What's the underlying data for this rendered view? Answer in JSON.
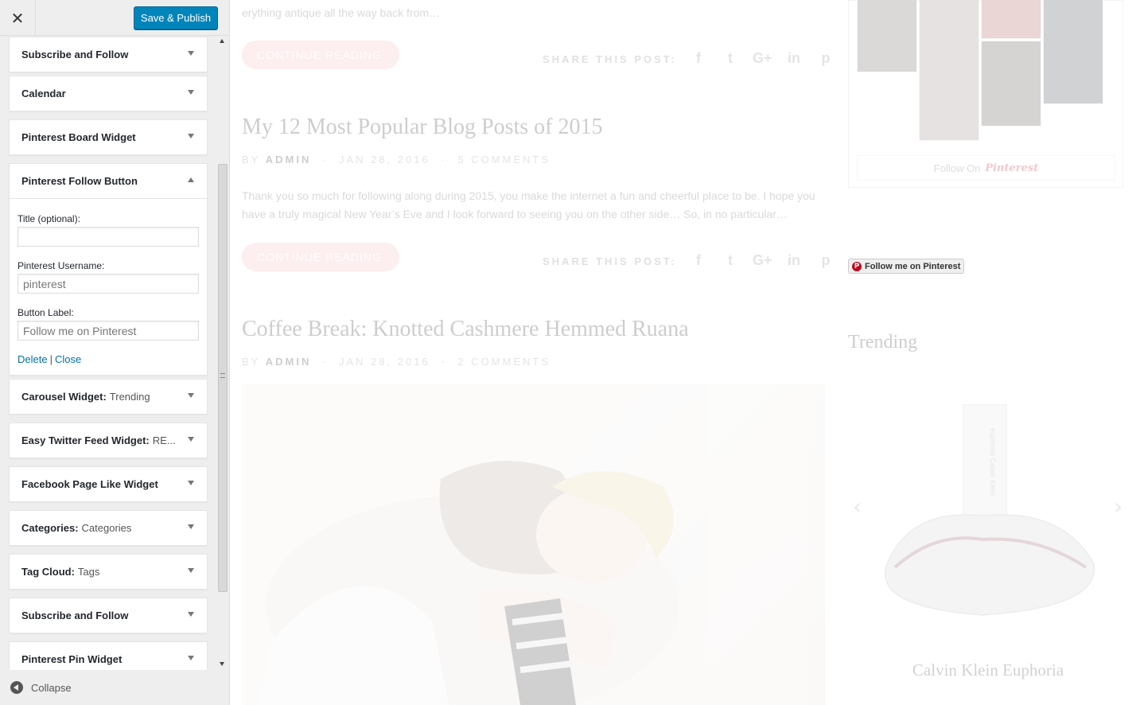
{
  "header": {
    "close_icon": "close-icon",
    "publish_label": "Save & Publish",
    "publish_color": "#0085ba"
  },
  "widgets": [
    {
      "title": "Subscribe and Follow",
      "subtitle": "",
      "expanded": false
    },
    {
      "title": "Calendar",
      "subtitle": "",
      "expanded": false
    },
    {
      "title": "Pinterest Board Widget",
      "subtitle": "",
      "expanded": false
    },
    {
      "title": "Pinterest Follow Button",
      "subtitle": "",
      "expanded": true
    },
    {
      "title": "Carousel Widget:",
      "subtitle": "Trending",
      "expanded": false
    },
    {
      "title": "Easy Twitter Feed Widget:",
      "subtitle": "RE...",
      "expanded": false
    },
    {
      "title": "Facebook Page Like Widget",
      "subtitle": "",
      "expanded": false
    },
    {
      "title": "Categories:",
      "subtitle": "Categories",
      "expanded": false
    },
    {
      "title": "Tag Cloud:",
      "subtitle": "Tags",
      "expanded": false
    },
    {
      "title": "Subscribe and Follow",
      "subtitle": "",
      "expanded": false
    },
    {
      "title": "Pinterest Pin Widget",
      "subtitle": "",
      "expanded": false
    }
  ],
  "follow_form": {
    "title_label": "Title (optional):",
    "title_value": "",
    "username_label": "Pinterest Username:",
    "username_placeholder": "pinterest",
    "button_label_label": "Button Label:",
    "button_label_placeholder": "Follow me on Pinterest",
    "delete_label": "Delete",
    "separator": "|",
    "close_label": "Close"
  },
  "footer": {
    "collapse_label": "Collapse"
  },
  "preview": {
    "top_excerpt": "erything antique all the way back from…",
    "continue_label": "CONTINUE READING",
    "share_label": "SHARE THIS POST:",
    "share_icons": [
      "f",
      "t",
      "G+",
      "in",
      "p"
    ],
    "posts": [
      {
        "title": "My 12 Most Popular Blog Posts of 2015",
        "by": "BY",
        "author": "ADMIN",
        "date": "JAN 28, 2016",
        "comments": "5 COMMENTS",
        "excerpt_line1": "Thank you so much for following along during 2015, you make the internet a fun and cheerful place to be. I hope you",
        "excerpt_line2": "have a truly magical New Year’s Eve and I look forward to seeing you on the other side… So, in no particular…"
      },
      {
        "title": "Coffee Break: Knotted Cashmere Hemmed Ruana",
        "by": "BY",
        "author": "ADMIN",
        "date": "JAN 28, 2016",
        "comments": "2 COMMENTS"
      }
    ],
    "pinterest_follow_prefix": "Follow On",
    "pinterest_brand": "Pinterest",
    "follow_button_label": "Follow me on Pinterest",
    "trending_title": "Trending",
    "product_name": "Calvin Klein Euphoria",
    "bottle_text": "euphoria Calvin Klein",
    "accent_pink": "#f7b6b9",
    "pinterest_red": "#bd081c"
  }
}
